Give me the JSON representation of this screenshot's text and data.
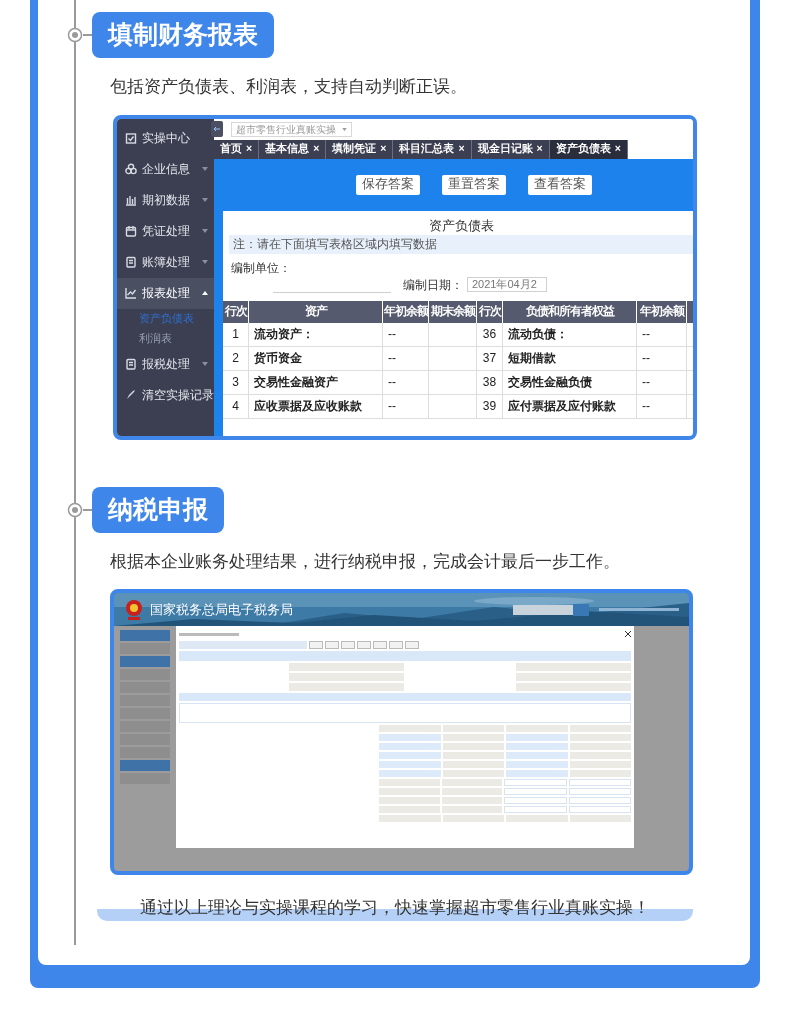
{
  "sections": [
    {
      "title": "填制财务报表",
      "description": "包括资产负债表、利润表，支持自动判断正误。",
      "screen": {
        "kind": "accounting",
        "sidebar": [
          {
            "label": "实操中心",
            "selected": false
          },
          {
            "label": "企业信息",
            "selected": false,
            "expanded": false
          },
          {
            "label": "期初数据",
            "selected": false,
            "expanded": false
          },
          {
            "label": "凭证处理",
            "selected": false,
            "expanded": false
          },
          {
            "label": "账簿处理",
            "selected": false,
            "expanded": false
          },
          {
            "label": "报表处理",
            "selected": true,
            "expanded": true,
            "children": [
              {
                "label": "资产负债表",
                "selected": true
              },
              {
                "label": "利润表",
                "selected": false
              }
            ]
          },
          {
            "label": "报税处理",
            "selected": false,
            "expanded": false
          },
          {
            "label": "清空实操记录",
            "selected": false
          }
        ],
        "dropdown": "超市零售行业真账实操",
        "tabs": [
          {
            "label": "首页",
            "selected": false
          },
          {
            "label": "基本信息",
            "selected": false
          },
          {
            "label": "填制凭证",
            "selected": false
          },
          {
            "label": "科目汇总表",
            "selected": false
          },
          {
            "label": "现金日记账",
            "selected": false
          },
          {
            "label": "资产负债表",
            "selected": true
          }
        ],
        "close_mark": "×",
        "buttons": [
          "保存答案",
          "重置答案",
          "查看答案"
        ],
        "report_title": "资产负债表",
        "note": "注：请在下面填写表格区域内填写数据",
        "unit_label": "编制单位：",
        "date_label": "编制日期：",
        "date_value": "2021年04月2",
        "columns": [
          "行次",
          "资产",
          "年初余额",
          "期末余额",
          "行次",
          "负债和所有者权益",
          "年初余额"
        ],
        "rows": [
          [
            "1",
            "流动资产：",
            "--",
            "",
            "36",
            "流动负债：",
            "--"
          ],
          [
            "2",
            "货币资金",
            "--",
            "",
            "37",
            "短期借款",
            "--"
          ],
          [
            "3",
            "交易性金融资产",
            "--",
            "",
            "38",
            "交易性金融负债",
            "--"
          ],
          [
            "4",
            "应收票据及应收账款",
            "--",
            "",
            "39",
            "应付票据及应付账款",
            "--"
          ]
        ]
      }
    },
    {
      "title": "纳税申报",
      "description": "根据本企业账务处理结果，进行纳税申报，完成会计最后一步工作。",
      "screen": {
        "kind": "tax",
        "site_title": "国家税务总局电子税务局"
      }
    }
  ],
  "footer": "通过以上理论与实操课程的学习，快速掌握超市零售行业真账实操！"
}
